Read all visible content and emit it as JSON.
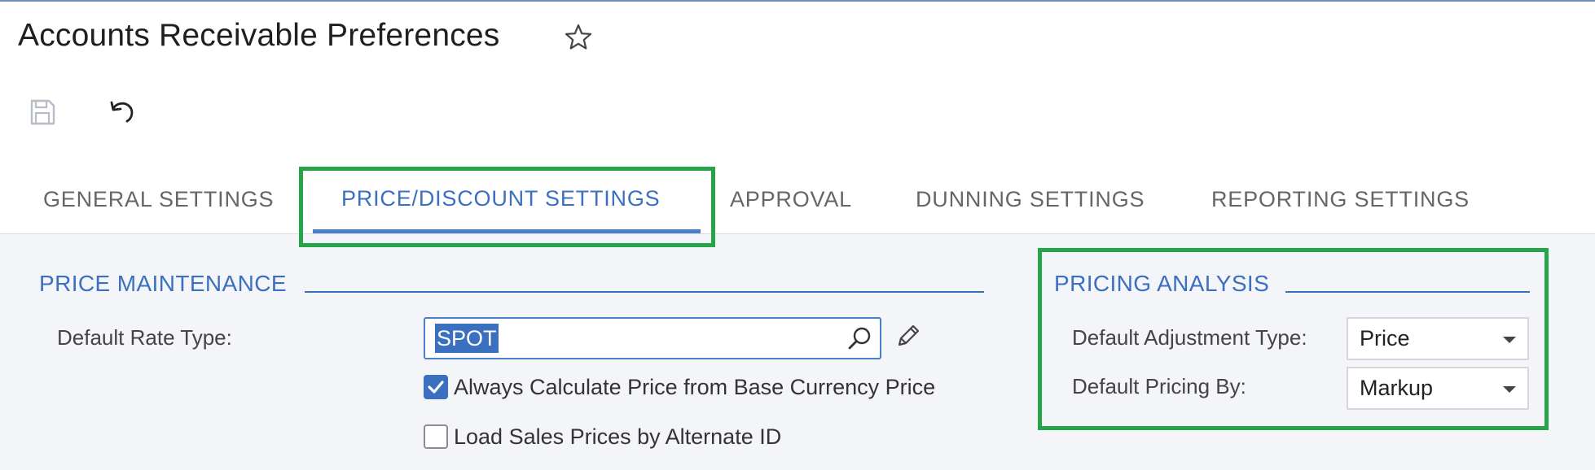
{
  "colors": {
    "accent": "#3b6fbf",
    "highlight": "#25a548",
    "content_bg": "#f4f5f8"
  },
  "header": {
    "title": "Accounts Receivable Preferences",
    "favorite_icon": "star-outline-icon"
  },
  "toolbar": {
    "save_icon": "save-disk-icon",
    "undo_icon": "undo-icon"
  },
  "tabs": [
    {
      "label": "GENERAL SETTINGS",
      "active": false
    },
    {
      "label": "PRICE/DISCOUNT SETTINGS",
      "active": true
    },
    {
      "label": "APPROVAL",
      "active": false
    },
    {
      "label": "DUNNING SETTINGS",
      "active": false
    },
    {
      "label": "REPORTING SETTINGS",
      "active": false
    }
  ],
  "price_maintenance": {
    "title": "PRICE MAINTENANCE",
    "default_rate_type": {
      "label": "Default Rate Type:",
      "value": "SPOT"
    },
    "always_calculate": {
      "label": "Always Calculate Price from Base Currency Price",
      "checked": true
    },
    "load_sales_prices": {
      "label": "Load Sales Prices by Alternate ID",
      "checked": false
    }
  },
  "pricing_analysis": {
    "title": "PRICING ANALYSIS",
    "default_adjustment_type": {
      "label": "Default Adjustment Type:",
      "value": "Price"
    },
    "default_pricing_by": {
      "label": "Default Pricing By:",
      "value": "Markup"
    }
  }
}
